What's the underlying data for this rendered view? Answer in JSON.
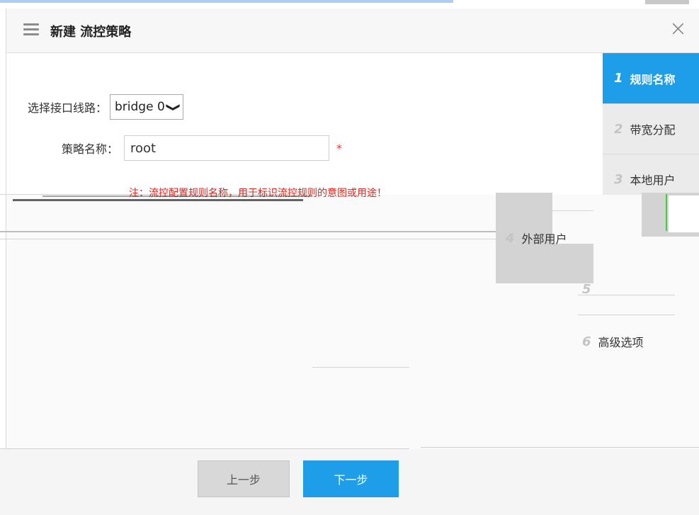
{
  "dialog": {
    "title": "新建 流控策略",
    "close_symbol": "×"
  },
  "form": {
    "interface_label": "选择接口线路：",
    "interface_value": "bridge 0",
    "interface_chevron": "❯",
    "policy_name_label": "策略名称：",
    "policy_name_value": "root",
    "required_mark": "*",
    "note": "注：流控配置规则名称，用于标识流控规则的意图或用途！"
  },
  "steps": [
    {
      "num": "1",
      "label": "规则名称",
      "active": true
    },
    {
      "num": "2",
      "label": "带宽分配",
      "active": false
    },
    {
      "num": "3",
      "label": "本地用户",
      "active": false
    },
    {
      "num": "4",
      "label": "外部用户",
      "active": false
    },
    {
      "num": "5",
      "label": "",
      "active": false
    },
    {
      "num": "6",
      "label": "高级选项",
      "active": false
    }
  ],
  "footer": {
    "prev_label": "上一步",
    "next_label": "下一步"
  },
  "colors": {
    "accent": "#1e9ee8",
    "warning": "#e0241b",
    "sidebar_bg": "#ebebeb"
  }
}
